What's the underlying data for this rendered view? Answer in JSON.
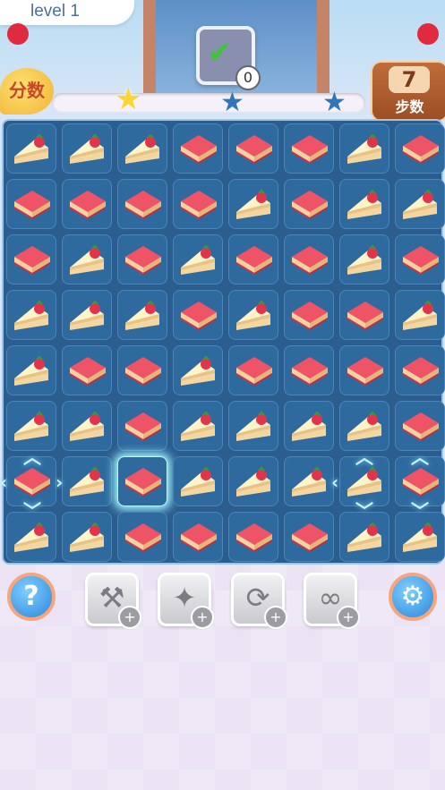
{
  "header": {
    "level_label": "level 1",
    "score_label": "分数",
    "goal_count": "0",
    "goal_icon": "check-icon",
    "moves_value": "7",
    "moves_label": "步数",
    "progress": 0.0,
    "stars": [
      "gold-star",
      "blue-star",
      "blue-star"
    ]
  },
  "board": {
    "rows": 8,
    "cols": 8,
    "pieces": [
      [
        "cheesecake",
        "cheesecake",
        "cheesecake",
        "strawberry-cube",
        "strawberry-cube",
        "strawberry-cube",
        "cheesecake",
        "strawberry-cube"
      ],
      [
        "strawberry-cube",
        "strawberry-cube",
        "strawberry-cube",
        "strawberry-cube",
        "cheesecake",
        "strawberry-cube",
        "cheesecake",
        "cheesecake"
      ],
      [
        "strawberry-cube",
        "cheesecake",
        "strawberry-cube",
        "cheesecake",
        "strawberry-cube",
        "strawberry-cube",
        "cheesecake",
        "strawberry-cube"
      ],
      [
        "cheesecake",
        "cheesecake",
        "cheesecake",
        "strawberry-cube",
        "cheesecake",
        "strawberry-cube",
        "strawberry-cube",
        "cheesecake"
      ],
      [
        "cheesecake",
        "strawberry-cube",
        "strawberry-cube",
        "cheesecake",
        "strawberry-cube",
        "strawberry-cube",
        "strawberry-cube",
        "strawberry-cube"
      ],
      [
        "cheesecake",
        "cheesecake",
        "strawberry-cube",
        "cheesecake",
        "cheesecake",
        "cheesecake",
        "cheesecake",
        "strawberry-cube"
      ],
      [
        "strawberry-cube",
        "cheesecake",
        "strawberry-cube",
        "cheesecake",
        "cheesecake",
        "cheesecake",
        "cheesecake",
        "strawberry-cube"
      ],
      [
        "cheesecake",
        "cheesecake",
        "strawberry-cube",
        "strawberry-cube",
        "strawberry-cube",
        "strawberry-cube",
        "cheesecake",
        "cheesecake"
      ]
    ],
    "highlighted_cell": {
      "row": 6,
      "col": 2
    }
  },
  "toolbar": {
    "help_icon": "help-icon",
    "settings_icon": "gear-icon",
    "tools": [
      {
        "name": "hammer-tool",
        "icon": "hammer-icon",
        "plus": "+"
      },
      {
        "name": "magic-wand-tool",
        "icon": "magic-wand-icon",
        "plus": "+"
      },
      {
        "name": "shuffle-tool",
        "icon": "shuffle-icon",
        "plus": "+"
      },
      {
        "name": "infinite-tool",
        "icon": "infinity-icon",
        "plus": "+"
      }
    ],
    "help_text": "?"
  },
  "colors": {
    "board_bg": "#2b5d8f",
    "cell_bg": "#2f6a9f",
    "cake_red": "#e6384a",
    "cake_cream": "#fff4cc",
    "accent_orange": "#f6a57d"
  }
}
